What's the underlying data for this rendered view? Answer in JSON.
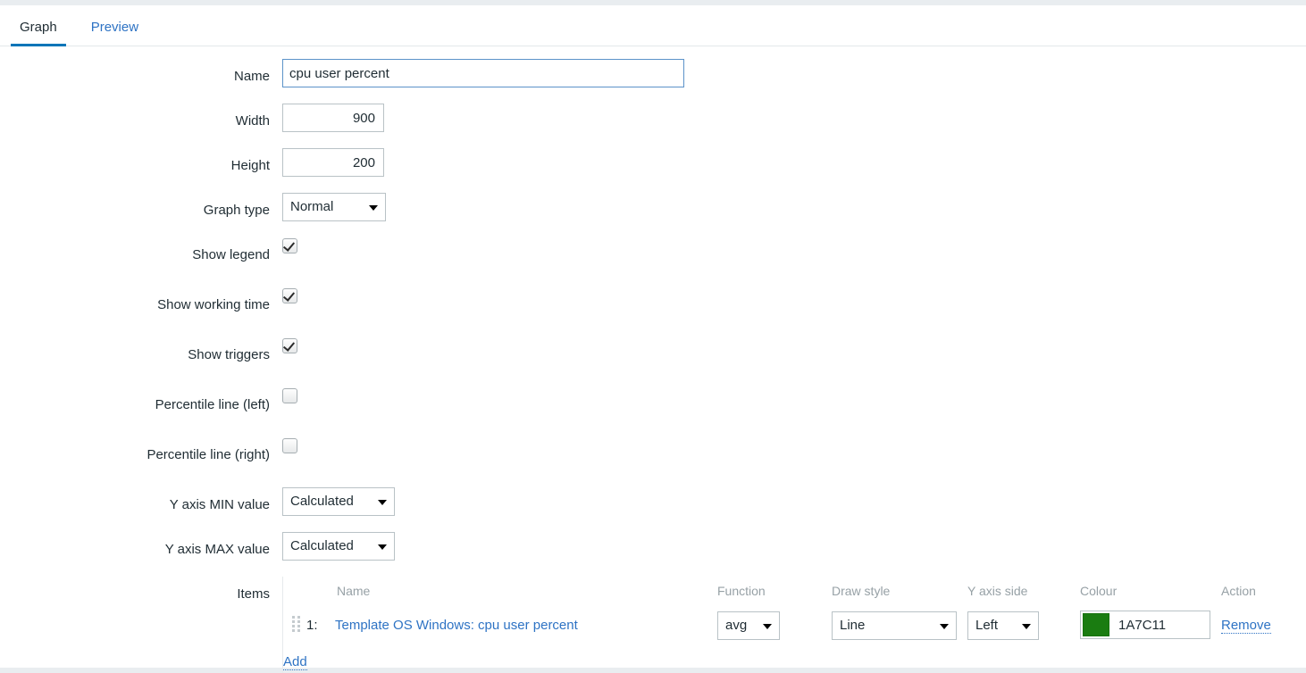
{
  "tabs": [
    {
      "label": "Graph",
      "active": true
    },
    {
      "label": "Preview",
      "active": false
    }
  ],
  "form": {
    "name": {
      "label": "Name",
      "value": "cpu user percent"
    },
    "width": {
      "label": "Width",
      "value": "900"
    },
    "height": {
      "label": "Height",
      "value": "200"
    },
    "graph_type": {
      "label": "Graph type",
      "value": "Normal"
    },
    "show_legend": {
      "label": "Show legend",
      "checked": true
    },
    "show_working_time": {
      "label": "Show working time",
      "checked": true
    },
    "show_triggers": {
      "label": "Show triggers",
      "checked": true
    },
    "percentile_left": {
      "label": "Percentile line (left)",
      "checked": false
    },
    "percentile_right": {
      "label": "Percentile line (right)",
      "checked": false
    },
    "y_axis_min": {
      "label": "Y axis MIN value",
      "value": "Calculated"
    },
    "y_axis_max": {
      "label": "Y axis MAX value",
      "value": "Calculated"
    },
    "items": {
      "label": "Items"
    }
  },
  "items_table": {
    "headers": {
      "name": "Name",
      "function": "Function",
      "draw_style": "Draw style",
      "y_axis_side": "Y axis side",
      "colour": "Colour",
      "action": "Action"
    },
    "rows": [
      {
        "index": "1:",
        "name": "Template OS Windows: cpu user percent",
        "function": "avg",
        "draw_style": "Line",
        "y_axis_side": "Left",
        "colour_hex": "1A7C11",
        "colour_swatch": "#1A7C11",
        "action": "Remove"
      }
    ],
    "add_label": "Add"
  },
  "colors": {
    "accent": "#0275b8",
    "link": "#2e73c4",
    "text": "#1f2c33",
    "muted": "#97a1a6",
    "item_colour": "#1A7C11"
  }
}
